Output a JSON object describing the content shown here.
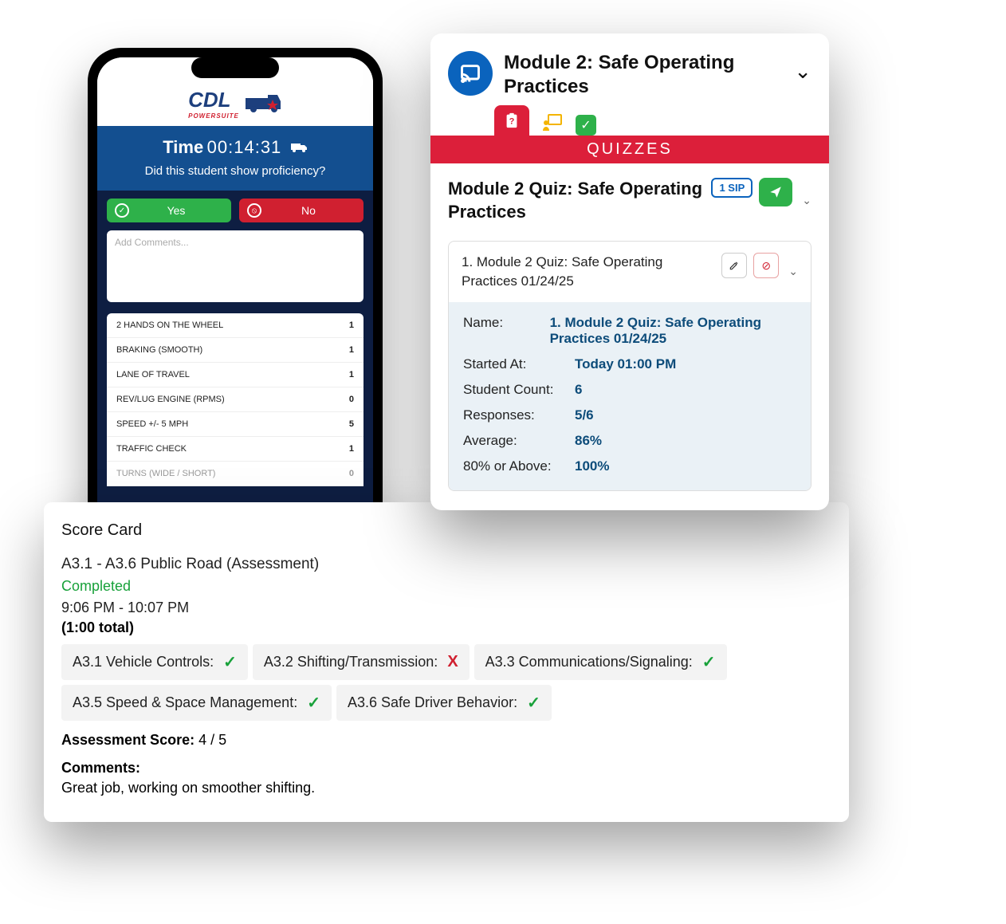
{
  "phone": {
    "logo_text": "CDL",
    "logo_sub": "POWERSUITE",
    "time_label": "Time",
    "time_value": "00:14:31",
    "prompt": "Did this student show proficiency?",
    "yes_label": "Yes",
    "no_label": "No",
    "comments_placeholder": "Add Comments...",
    "metrics": [
      {
        "label": "2 HANDS ON THE WHEEL",
        "value": "1"
      },
      {
        "label": "BRAKING (SMOOTH)",
        "value": "1"
      },
      {
        "label": "LANE OF TRAVEL",
        "value": "1"
      },
      {
        "label": "REV/LUG ENGINE (RPMS)",
        "value": "0"
      },
      {
        "label": "SPEED +/- 5 MPH",
        "value": "5"
      },
      {
        "label": "TRAFFIC CHECK",
        "value": "1"
      },
      {
        "label": "TURNS (WIDE / SHORT)",
        "value": "0"
      }
    ]
  },
  "scorecard": {
    "title": "Score Card",
    "assessment_label": "A3.1 - A3.6 Public Road (Assessment)",
    "status": "Completed",
    "time_range": "9:06 PM - 10:07 PM",
    "total": "(1:00 total)",
    "row1": {
      "a31": "A3.1 Vehicle Controls:",
      "a31_mark": "✓",
      "a32": "A3.2 Shifting/Transmission:",
      "a32_mark": "X",
      "a33": "A3.3 Communications/Signaling:",
      "a33_mark": "✓"
    },
    "row2": {
      "a35": "A3.5 Speed & Space Management:",
      "a35_mark": "✓",
      "a36": "A3.6 Safe Driver Behavior:",
      "a36_mark": "✓"
    },
    "score_label": "Assessment Score:",
    "score_value": "4 / 5",
    "comments_label": "Comments:",
    "comments_text": "Great job, working on smoother shifting."
  },
  "module": {
    "title": "Module 2: Safe Operating Practices",
    "tab_bar_label": "QUIZZES",
    "quiz_title": "Module 2 Quiz: Safe Operating Practices",
    "sip_count": "1",
    "sip_label": "SIP",
    "item_title": "1. Module 2 Quiz: Safe Operating Practices 01/24/25",
    "details": {
      "name_label": "Name:",
      "name_value": "1. Module 2 Quiz: Safe Operating Practices 01/24/25",
      "started_label": "Started At:",
      "started_value": "Today 01:00 PM",
      "count_label": "Student Count:",
      "count_value": "6",
      "responses_label": "Responses:",
      "responses_value": "5/6",
      "average_label": "Average:",
      "average_value": "86%",
      "pass_label": "80% or Above:",
      "pass_value": "100%"
    }
  }
}
